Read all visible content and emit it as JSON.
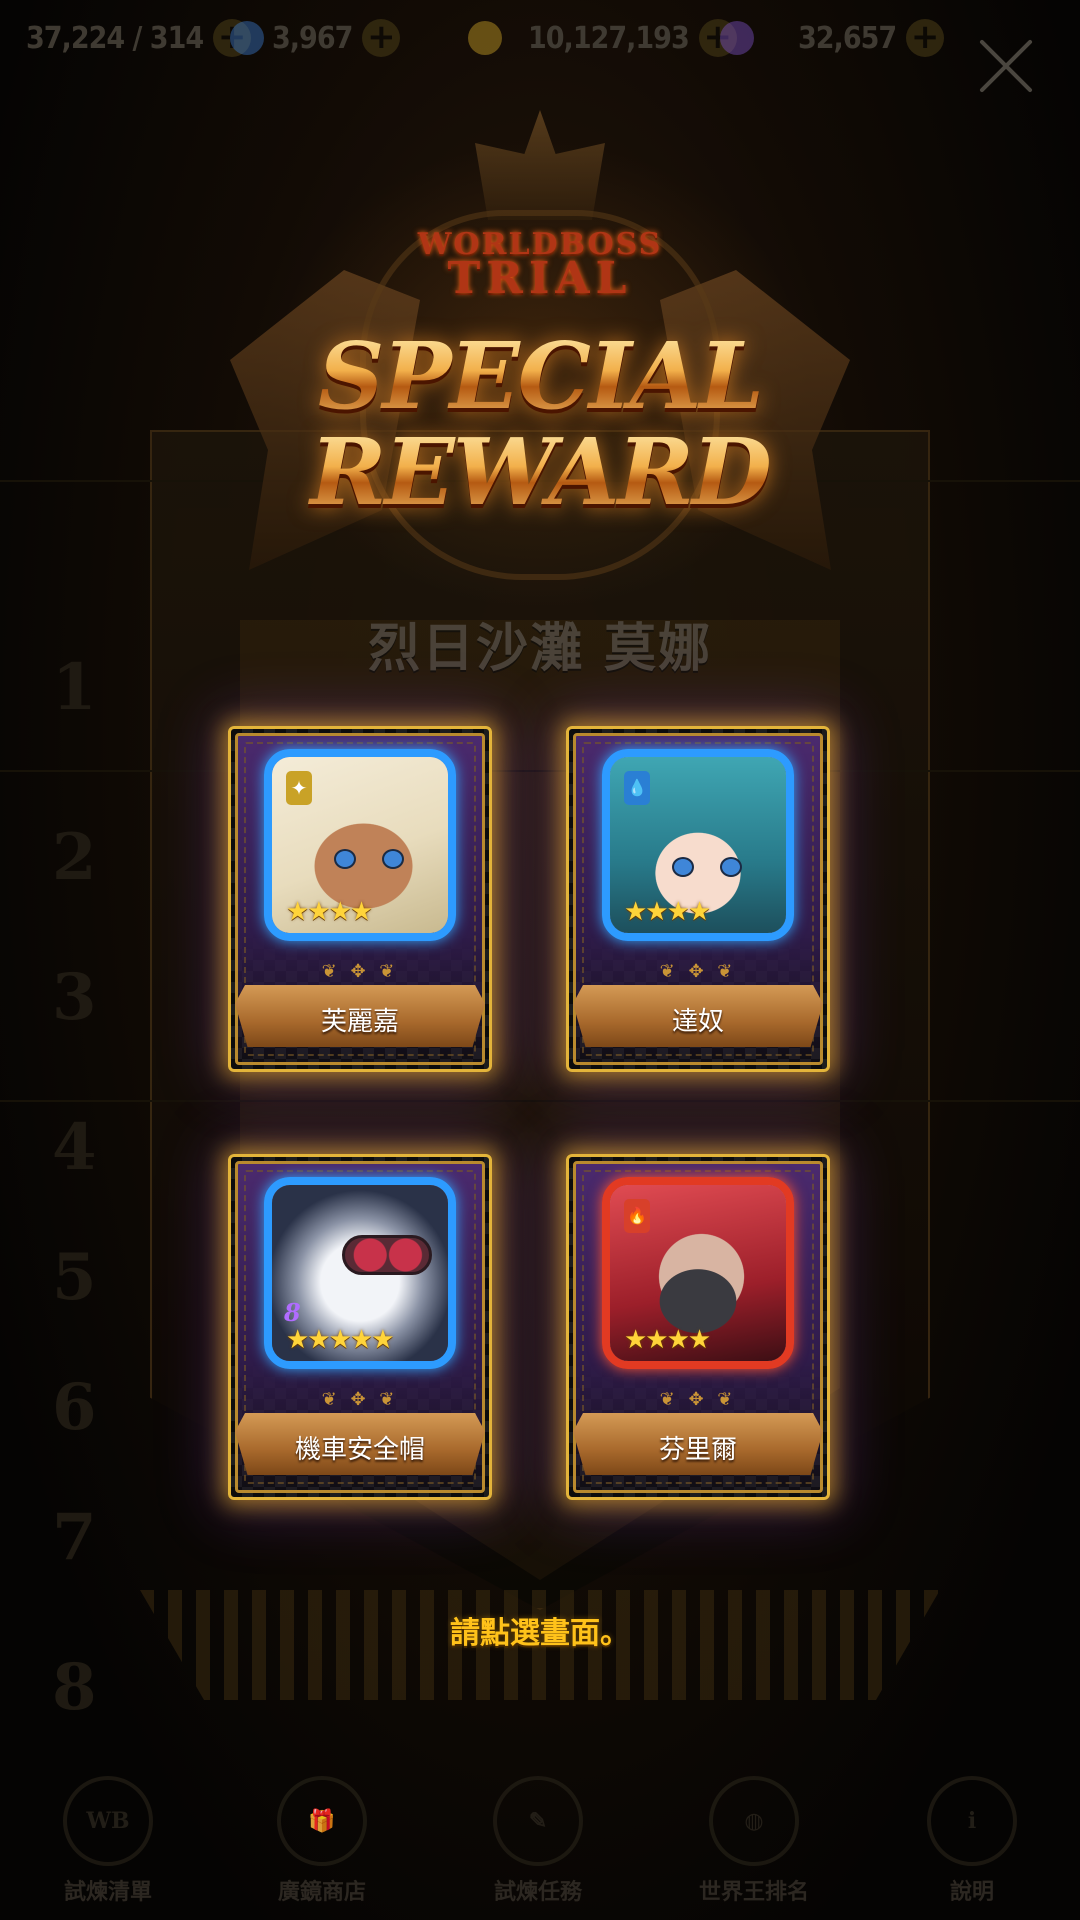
{
  "resources": [
    {
      "value": "37,224 / 314",
      "icon": "stamina-icon",
      "color": "#c0392b"
    },
    {
      "value": "3,967",
      "icon": "blue-gem-icon",
      "color": "#3a78c8"
    },
    {
      "value": "10,127,193",
      "icon": "gold-coin-icon",
      "color": "#c9a227"
    },
    {
      "value": "32,657",
      "icon": "purple-crystal-icon",
      "color": "#7b4fc4"
    }
  ],
  "emblem": {
    "line1": "WORLDBOSS",
    "line2": "TRIAL",
    "title1": "SPECIAL",
    "title2": "REWARD"
  },
  "subtitle": "烈日沙灘 莫娜",
  "rewards": [
    {
      "name": "芙麗嘉",
      "stars": "★★★★",
      "element": "light",
      "element_glyph": "✦",
      "element_color": "#c9a227",
      "frame_color": "blue"
    },
    {
      "name": "達奴",
      "stars": "★★★★",
      "element": "water",
      "element_glyph": "💧",
      "element_color": "#2a7fd4",
      "frame_color": "blue"
    },
    {
      "name": "機車安全帽",
      "stars": "★★★★★",
      "element": "",
      "level": "8",
      "frame_color": "blue"
    },
    {
      "name": "芬里爾",
      "stars": "★★★★",
      "element": "fire",
      "element_glyph": "🔥",
      "element_color": "#d8402a",
      "frame_color": "red"
    }
  ],
  "prompt": "請點選畫面。",
  "bottom_nav": [
    {
      "label": "試煉清單",
      "icon": "world-boss-icon"
    },
    {
      "label": "廣鏡商店",
      "icon": "gift-shop-icon"
    },
    {
      "label": "試煉任務",
      "icon": "trial-quest-icon"
    },
    {
      "label": "世界王排名",
      "icon": "rank-globe-icon"
    },
    {
      "label": "說明",
      "icon": "info-icon"
    }
  ],
  "accent_color": "#ffc21a"
}
